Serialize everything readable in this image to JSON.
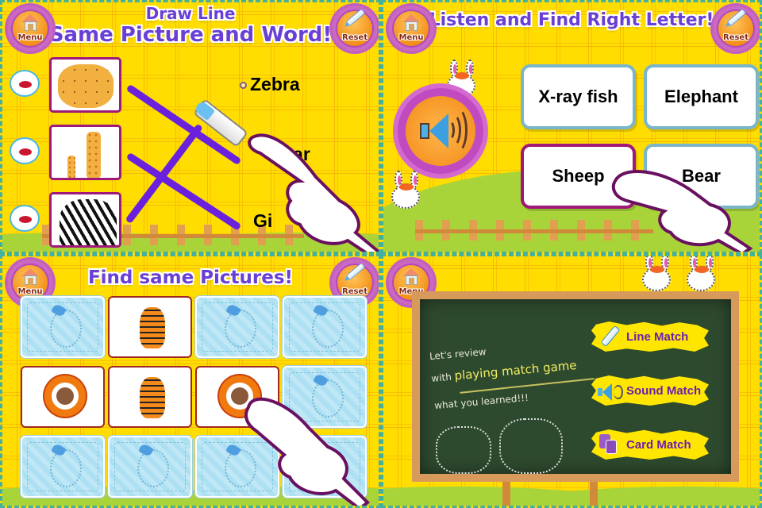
{
  "colors": {
    "background_yellow": "#ffdd00",
    "title_purple": "#6a3fd6",
    "button_orange": "#f39019",
    "button_purple": "#b34ab8",
    "line_purple": "#6a20dd",
    "card_border_magenta": "#a01878",
    "card_border_blue": "#7ab5c9",
    "chalkboard_green": "#2e4a2e",
    "menu_option_yellow": "#ffe600",
    "menu_option_text": "#6a1fb0"
  },
  "common": {
    "menu_label": "Menu",
    "reset_label": "Reset",
    "menu_icon": "house-icon",
    "reset_icon": "crayon-icon"
  },
  "line_match": {
    "title_line1": "Draw Line",
    "title_line2": "Same Picture and Word!",
    "pictures": [
      {
        "name": "jaguar",
        "sound_icon": "lips-icon"
      },
      {
        "name": "giraffe",
        "sound_icon": "lips-icon"
      },
      {
        "name": "zebra",
        "sound_icon": "lips-icon"
      }
    ],
    "words": [
      "Zebra",
      "Jaguar",
      "Giraffe"
    ],
    "words_visible": [
      "Zebra",
      "uar",
      "Gi"
    ]
  },
  "sound_match": {
    "title": "Listen and Find Right Letter!",
    "speaker_icon": "speaker-icon",
    "answers": [
      {
        "label": "X-ray fish",
        "selected": false
      },
      {
        "label": "Elephant",
        "selected": false
      },
      {
        "label": "Sheep",
        "selected": true
      },
      {
        "label": "Bear",
        "selected": false
      }
    ]
  },
  "card_match": {
    "title": "Find same Pictures!",
    "cards": [
      {
        "state": "back"
      },
      {
        "state": "face",
        "picture": "tiger"
      },
      {
        "state": "back"
      },
      {
        "state": "back"
      },
      {
        "state": "face",
        "picture": "bull"
      },
      {
        "state": "face",
        "picture": "tiger"
      },
      {
        "state": "face",
        "picture": "bull"
      },
      {
        "state": "back"
      },
      {
        "state": "back"
      },
      {
        "state": "back"
      },
      {
        "state": "back"
      },
      {
        "state": "back"
      }
    ]
  },
  "main_menu": {
    "chalk_line1": "Let's review",
    "chalk_line2_prefix": "with",
    "chalk_line2_highlight": "playing match game",
    "chalk_line3": "what you learned!!!",
    "options": [
      {
        "label": "Line Match",
        "icon": "crayon-icon"
      },
      {
        "label": "Sound Match",
        "icon": "speaker-icon"
      },
      {
        "label": "Card Match",
        "icon": "cards-icon"
      }
    ]
  }
}
